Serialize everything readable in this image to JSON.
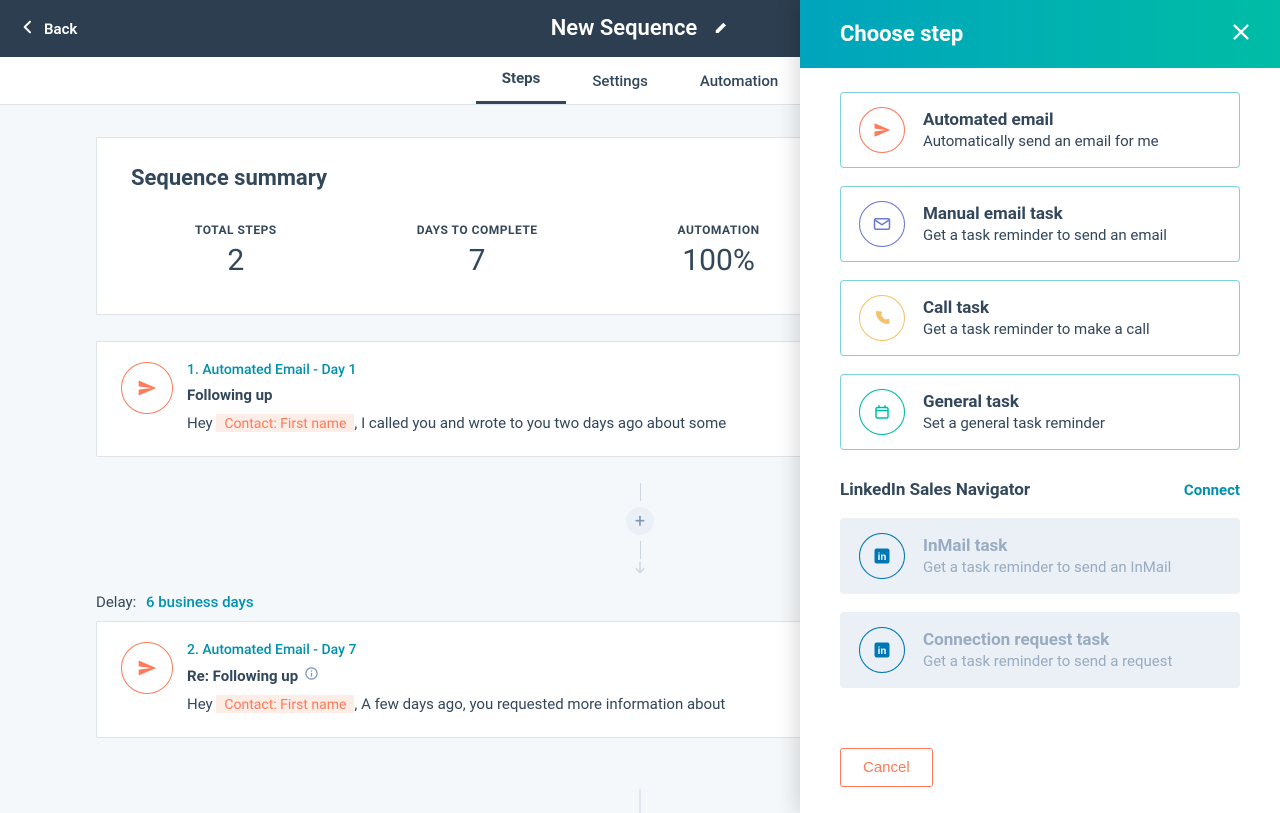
{
  "header": {
    "back_label": "Back",
    "title": "New Sequence"
  },
  "tabs": [
    {
      "label": "Steps",
      "active": true
    },
    {
      "label": "Settings",
      "active": false
    },
    {
      "label": "Automation",
      "active": false
    }
  ],
  "summary": {
    "heading": "Sequence summary",
    "items": [
      {
        "label": "TOTAL STEPS",
        "value": "2"
      },
      {
        "label": "DAYS TO COMPLETE",
        "value": "7"
      },
      {
        "label": "AUTOMATION",
        "value": "100%"
      }
    ]
  },
  "steps": [
    {
      "title": "1. Automated Email - Day 1",
      "subject": "Following up",
      "has_info": false,
      "preview_before": "Hey ",
      "token": "Contact: First name",
      "preview_after": ", I called you and wrote to you two days ago about some"
    },
    {
      "title": "2. Automated Email - Day 7",
      "subject": "Re: Following up",
      "has_info": true,
      "preview_before": "Hey ",
      "token": "Contact: First name",
      "preview_after": ", A few days ago, you requested more information about"
    }
  ],
  "delay": {
    "label": "Delay:",
    "value": "6 business days"
  },
  "panel": {
    "title": "Choose step",
    "options": [
      {
        "icon": "send",
        "color": "orange",
        "title": "Automated email",
        "desc": "Automatically send an email for me"
      },
      {
        "icon": "mail",
        "color": "purple",
        "title": "Manual email task",
        "desc": "Get a task reminder to send an email"
      },
      {
        "icon": "phone",
        "color": "yellow",
        "title": "Call task",
        "desc": "Get a task reminder to make a call"
      },
      {
        "icon": "task",
        "color": "teal",
        "title": "General task",
        "desc": "Set a general task reminder"
      }
    ],
    "linkedin_heading": "LinkedIn Sales Navigator",
    "connect_label": "Connect",
    "linkedin_options": [
      {
        "icon": "linkedin",
        "color": "blue",
        "title": "InMail task",
        "desc": "Get a task reminder to send an InMail"
      },
      {
        "icon": "linkedin",
        "color": "blue",
        "title": "Connection request task",
        "desc": "Get a task reminder to send a request"
      }
    ],
    "cancel_label": "Cancel"
  }
}
